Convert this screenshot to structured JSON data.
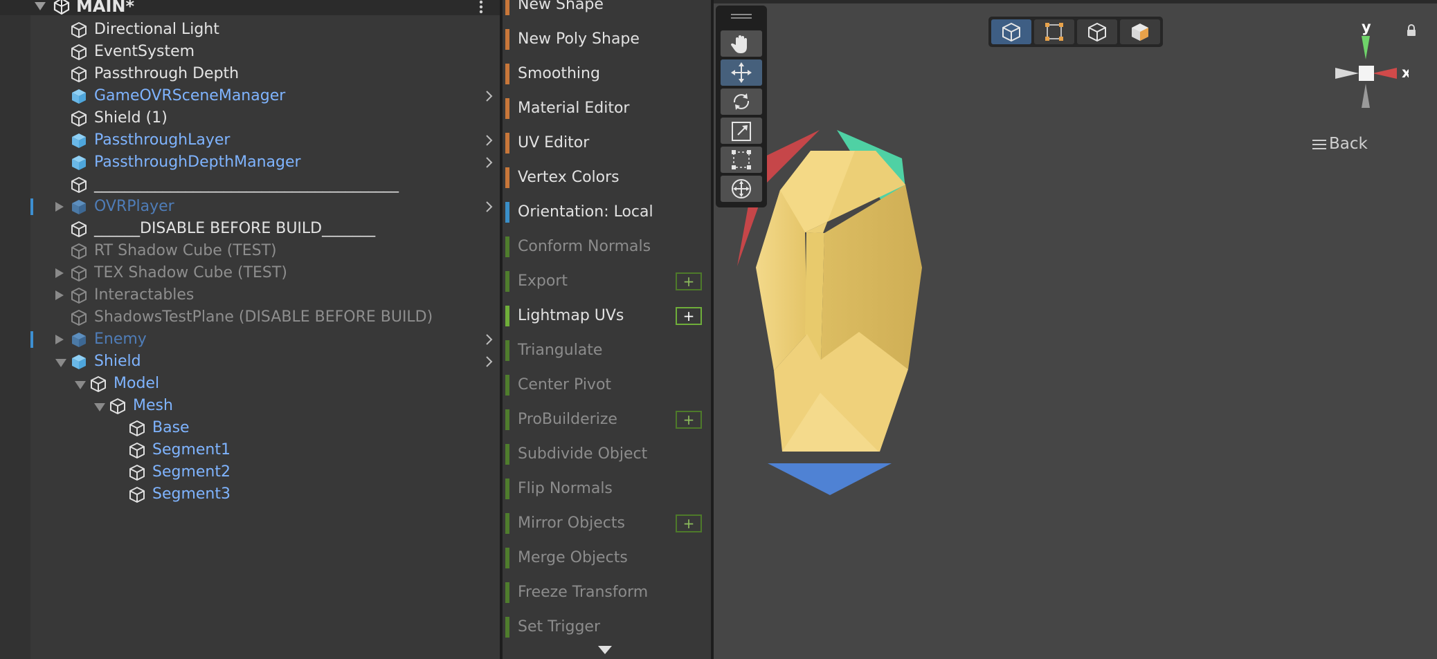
{
  "hierarchy": {
    "scene_name": "MAIN*",
    "rows": [
      {
        "label": "Directional Light",
        "depth": 0,
        "color": "white",
        "icon": "gameobject-icon",
        "fold": "",
        "chevron": false,
        "marked": false
      },
      {
        "label": "EventSystem",
        "depth": 0,
        "color": "white",
        "icon": "gameobject-icon",
        "fold": "",
        "chevron": false,
        "marked": false
      },
      {
        "label": "Passthrough Depth",
        "depth": 0,
        "color": "white",
        "icon": "gameobject-icon",
        "fold": "",
        "chevron": false,
        "marked": false
      },
      {
        "label": "GameOVRSceneManager",
        "depth": 0,
        "color": "blue",
        "icon": "prefab-icon",
        "fold": "",
        "chevron": true,
        "marked": false
      },
      {
        "label": "Shield (1)",
        "depth": 0,
        "color": "white",
        "icon": "gameobject-icon",
        "fold": "",
        "chevron": false,
        "marked": false
      },
      {
        "label": "PassthroughLayer",
        "depth": 0,
        "color": "blue",
        "icon": "prefab-icon",
        "fold": "",
        "chevron": true,
        "marked": false
      },
      {
        "label": "PassthroughDepthManager",
        "depth": 0,
        "color": "blue",
        "icon": "prefab-icon",
        "fold": "",
        "chevron": true,
        "marked": false
      },
      {
        "label": "________________________________________",
        "depth": 0,
        "color": "white",
        "icon": "gameobject-icon",
        "fold": "",
        "chevron": false,
        "marked": false
      },
      {
        "label": "OVRPlayer",
        "depth": 0,
        "color": "dblue",
        "icon": "prefab-icon",
        "fold": "closed",
        "chevron": true,
        "marked": true
      },
      {
        "label": "______DISABLE BEFORE BUILD_______",
        "depth": 0,
        "color": "white",
        "icon": "gameobject-icon",
        "fold": "",
        "chevron": false,
        "marked": false
      },
      {
        "label": "RT Shadow Cube (TEST)",
        "depth": 0,
        "color": "grey",
        "icon": "gameobject-icon",
        "fold": "",
        "chevron": false,
        "marked": false
      },
      {
        "label": "TEX Shadow Cube (TEST)",
        "depth": 0,
        "color": "grey",
        "icon": "gameobject-icon",
        "fold": "closed",
        "chevron": false,
        "marked": false
      },
      {
        "label": "Interactables",
        "depth": 0,
        "color": "grey",
        "icon": "gameobject-icon",
        "fold": "closed",
        "chevron": false,
        "marked": false
      },
      {
        "label": "ShadowsTestPlane (DISABLE BEFORE BUILD)",
        "depth": 0,
        "color": "grey",
        "icon": "gameobject-icon",
        "fold": "",
        "chevron": false,
        "marked": false
      },
      {
        "label": "Enemy",
        "depth": 0,
        "color": "dblue",
        "icon": "prefab-icon",
        "fold": "closed",
        "chevron": true,
        "marked": true
      },
      {
        "label": "Shield",
        "depth": 0,
        "color": "blue",
        "icon": "prefab-icon",
        "fold": "open",
        "chevron": true,
        "marked": false
      },
      {
        "label": "Model",
        "depth": 1,
        "color": "blue",
        "icon": "gameobject-icon",
        "fold": "open",
        "chevron": false,
        "marked": false
      },
      {
        "label": "Mesh",
        "depth": 2,
        "color": "blue",
        "icon": "gameobject-icon",
        "fold": "open",
        "chevron": false,
        "marked": false
      },
      {
        "label": "Base",
        "depth": 3,
        "color": "blue",
        "icon": "gameobject-icon",
        "fold": "",
        "chevron": false,
        "marked": false
      },
      {
        "label": "Segment1",
        "depth": 3,
        "color": "blue",
        "icon": "gameobject-icon",
        "fold": "",
        "chevron": false,
        "marked": false
      },
      {
        "label": "Segment2",
        "depth": 3,
        "color": "blue",
        "icon": "gameobject-icon",
        "fold": "",
        "chevron": false,
        "marked": false
      },
      {
        "label": "Segment3",
        "depth": 3,
        "color": "blue",
        "icon": "gameobject-icon",
        "fold": "",
        "chevron": false,
        "marked": false
      }
    ]
  },
  "probuilder_tools": [
    {
      "label": "New Shape",
      "bar": "#c8773a",
      "enabled": true,
      "plus": false
    },
    {
      "label": "New Poly Shape",
      "bar": "#c8773a",
      "enabled": true,
      "plus": false
    },
    {
      "label": "Smoothing",
      "bar": "#c8773a",
      "enabled": true,
      "plus": false
    },
    {
      "label": "Material Editor",
      "bar": "#c8773a",
      "enabled": true,
      "plus": false
    },
    {
      "label": "UV Editor",
      "bar": "#c8773a",
      "enabled": true,
      "plus": false
    },
    {
      "label": "Vertex Colors",
      "bar": "#c8773a",
      "enabled": true,
      "plus": false
    },
    {
      "label": "Orientation: Local",
      "bar": "#3a8fc8",
      "enabled": true,
      "plus": false
    },
    {
      "label": "Conform Normals",
      "bar": "#4f7d2d",
      "enabled": false,
      "plus": false
    },
    {
      "label": "Export",
      "bar": "#4f7d2d",
      "enabled": false,
      "plus": true
    },
    {
      "label": "Lightmap UVs",
      "bar": "#6fae3a",
      "enabled": true,
      "plus": true
    },
    {
      "label": "Triangulate",
      "bar": "#4f7d2d",
      "enabled": false,
      "plus": false
    },
    {
      "label": "Center Pivot",
      "bar": "#4f7d2d",
      "enabled": false,
      "plus": false
    },
    {
      "label": "ProBuilderize",
      "bar": "#4f7d2d",
      "enabled": false,
      "plus": true
    },
    {
      "label": "Subdivide Object",
      "bar": "#4f7d2d",
      "enabled": false,
      "plus": false
    },
    {
      "label": "Flip Normals",
      "bar": "#4f7d2d",
      "enabled": false,
      "plus": false
    },
    {
      "label": "Mirror Objects",
      "bar": "#4f7d2d",
      "enabled": false,
      "plus": true
    },
    {
      "label": "Merge Objects",
      "bar": "#4f7d2d",
      "enabled": false,
      "plus": false
    },
    {
      "label": "Freeze Transform",
      "bar": "#4f7d2d",
      "enabled": false,
      "plus": false
    },
    {
      "label": "Set Trigger",
      "bar": "#4f7d2d",
      "enabled": false,
      "plus": false
    }
  ],
  "plus_glyph": "+",
  "scene_view": {
    "tools": [
      "hand-tool",
      "move-tool",
      "rotate-tool",
      "scale-tool",
      "rect-tool",
      "transform-tool"
    ],
    "active_tool": "move-tool",
    "select_modes": [
      "object-mode",
      "vertex-mode",
      "edge-mode",
      "face-mode"
    ],
    "active_mode": "object-mode",
    "gizmo": {
      "y_label": "y",
      "x_label": "x"
    },
    "view_label": "Back",
    "colors": {
      "shield": "#e8c86a",
      "x_axis": "#d04a4a",
      "y_axis": "#6fd46a",
      "z_axis": "#4e82d6",
      "teal": "#3ecf9a"
    }
  }
}
